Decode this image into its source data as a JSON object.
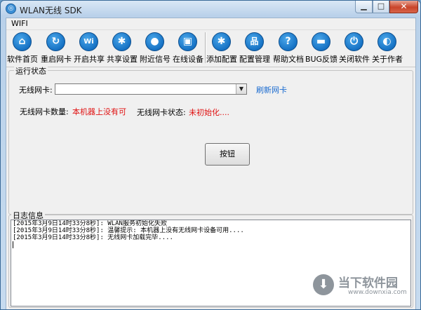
{
  "window": {
    "title": "WLAN无线 SDK",
    "min_label": "▁",
    "max_label": "□",
    "close_label": "✕"
  },
  "menu": {
    "items": [
      "WIFI"
    ]
  },
  "toolbar": {
    "buttons": [
      {
        "label": "软件首页",
        "icon": "home-icon",
        "glyph": "⌂"
      },
      {
        "label": "重启网卡",
        "icon": "refresh-icon",
        "glyph": "↻"
      },
      {
        "label": "开启共享",
        "icon": "wifi-icon",
        "glyph": "Wi"
      },
      {
        "label": "共享设置",
        "icon": "gear-icon",
        "glyph": "✱"
      },
      {
        "label": "附近信号",
        "icon": "location-pin-icon",
        "glyph": "●"
      },
      {
        "label": "在线设备",
        "icon": "android-icon",
        "glyph": "▣"
      },
      {
        "label": "添加配置",
        "icon": "gear-add-icon",
        "glyph": "✱"
      },
      {
        "label": "配置管理",
        "icon": "sitemap-icon",
        "glyph": "品"
      },
      {
        "label": "帮助文档",
        "icon": "help-icon",
        "glyph": "?"
      },
      {
        "label": "BUG反馈",
        "icon": "chat-icon",
        "glyph": "▬"
      },
      {
        "label": "关闭软件",
        "icon": "power-icon",
        "glyph": "⏻"
      },
      {
        "label": "关于作者",
        "icon": "firefox-icon",
        "glyph": "◐"
      }
    ]
  },
  "status": {
    "group_title": "运行状态",
    "adapter_label": "无线网卡:",
    "adapter_value": "",
    "refresh_link": "刷新网卡",
    "count_label": "无线网卡数量:",
    "count_value": "本机器上没有可",
    "state_label": "无线网卡状态:",
    "state_value": "未初始化....",
    "button_label": "按钮"
  },
  "log": {
    "group_title": "日志信息",
    "lines": [
      "[2015年3月9日14时33分8秒]: WLAN服务初始化失败",
      "[2015年3月9日14时33分8秒]: 温馨提示: 本机器上没有无线网卡设备可用....",
      "[2015年3月9日14时33分8秒]: 无线网卡加载完毕...."
    ]
  },
  "watermark": {
    "name": "当下软件园",
    "url": "www.downxia.com"
  },
  "colors": {
    "accent": "#1672c4",
    "error_text": "#e01010",
    "link": "#1a6bd0"
  }
}
